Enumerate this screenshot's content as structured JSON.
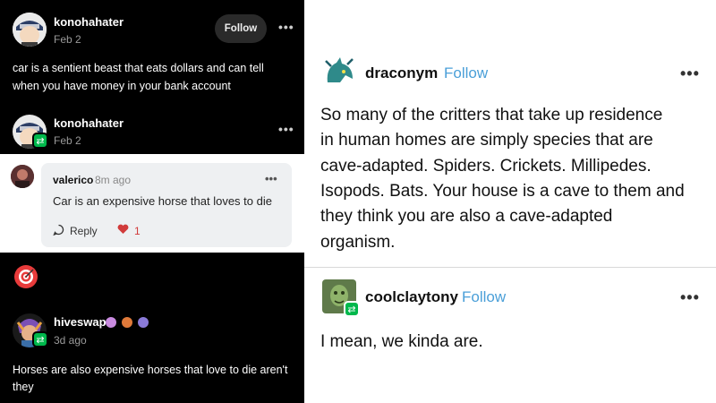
{
  "left": {
    "post": {
      "username": "konohahater",
      "date": "Feb 2",
      "follow_label": "Follow",
      "menu": "•••",
      "text_line1": "car is a sentient beast that eats dollars and can tell",
      "text_line2": "when you have money in your bank account"
    },
    "reblog": {
      "username": "konohahater",
      "date": "Feb 2",
      "menu": "•••",
      "reblog_icon": "⇄"
    },
    "comment": {
      "username": "valerico",
      "time": "8m ago",
      "menu": "•••",
      "text": "Car is an expensive horse that loves to die",
      "reply_label": "Reply",
      "like_count": "1"
    },
    "reblog2": {
      "username": "hiveswap",
      "date": "3d ago",
      "reblog_icon": "⇄",
      "text_line1": "Horses are also expensive horses that love to die aren't",
      "text_line2": "they"
    }
  },
  "right": {
    "post": {
      "username": "draconym",
      "follow_label": "Follow",
      "menu": "•••",
      "lines": [
        "So many of the critters that take up residence",
        "in human homes are simply species that are",
        "cave-adapted. Spiders. Crickets. Millipedes.",
        "Isopods. Bats. Your house is a cave to them and",
        "they think you are also a cave-adapted",
        "organism."
      ]
    },
    "reblog": {
      "username": "coolclaytony",
      "follow_label": "Follow",
      "menu": "•••",
      "reblog_icon": "⇄",
      "text": "I mean, we kinda are."
    }
  },
  "colors": {
    "follow_blue": "#4a9fd8",
    "reblog_green": "#00b84c",
    "like_red": "#d13b3b"
  }
}
